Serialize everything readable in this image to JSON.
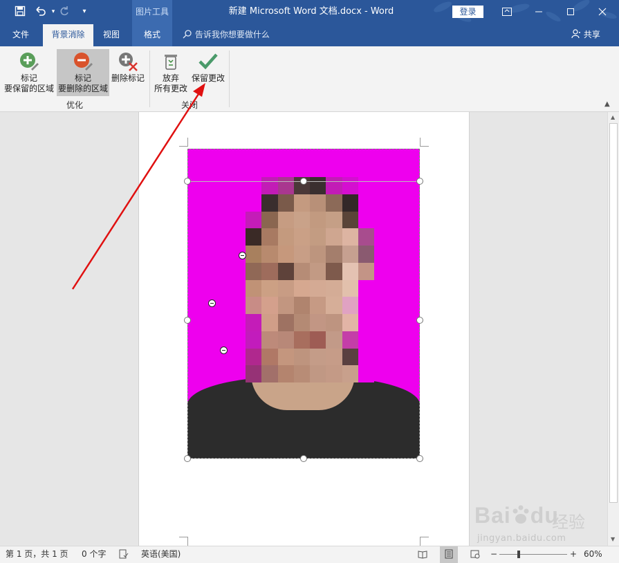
{
  "titlebar": {
    "context_tool": "图片工具",
    "doc_title": "新建 Microsoft Word 文档.docx  -  Word",
    "login": "登录",
    "save_icon": "save-icon",
    "undo_icon": "undo-icon",
    "redo_icon": "redo-icon"
  },
  "tabs": {
    "file": "文件",
    "bg_remove": "背景消除",
    "view": "视图",
    "format": "格式",
    "tellme": "告诉我你想要做什么",
    "share": "共享"
  },
  "ribbon": {
    "mark_keep_1": "标记",
    "mark_keep_2": "要保留的区域",
    "mark_remove_1": "标记",
    "mark_remove_2": "要删除的区域",
    "delete_mark": "删除标记",
    "discard_1": "放弃",
    "discard_2": "所有更改",
    "keep_changes": "保留更改",
    "group_refine": "优化",
    "group_close": "关闭"
  },
  "statusbar": {
    "page": "第 1 页，共 1 页",
    "words": "0 个字",
    "language": "英语(美国)",
    "zoom": "60%"
  },
  "watermark": {
    "brand": "Bai",
    "brand2": "du",
    "cn": "经验",
    "url": "jingyan.baidu.com"
  },
  "colors": {
    "accent": "#2b579a",
    "removed_bg": "#ee00ee",
    "arrow": "#e01010"
  }
}
